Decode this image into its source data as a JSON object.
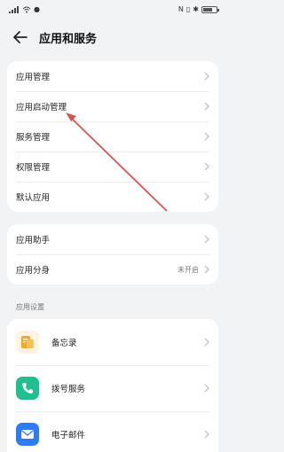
{
  "status_bar": {
    "left_icons": [
      "signal-icon",
      "wifi-icon",
      "notification-icon"
    ],
    "right_icons": [
      "nfc-icon",
      "vibrate-icon",
      "bluetooth-icon"
    ]
  },
  "header": {
    "title": "应用和服务",
    "back_icon": "back-arrow-icon"
  },
  "group1": [
    {
      "label": "应用管理"
    },
    {
      "label": "应用启动管理"
    },
    {
      "label": "服务管理"
    },
    {
      "label": "权限管理"
    },
    {
      "label": "默认应用"
    }
  ],
  "group2": [
    {
      "label": "应用助手",
      "value": ""
    },
    {
      "label": "应用分身",
      "value": "未开启"
    }
  ],
  "section_app_settings": "应用设置",
  "apps": [
    {
      "label": "备忘录",
      "icon": "memo-icon",
      "color": "#f5a623"
    },
    {
      "label": "拨号服务",
      "icon": "phone-icon",
      "color": "#1fbf8f"
    },
    {
      "label": "电子邮件",
      "icon": "email-icon",
      "color": "#2f7bf6"
    }
  ],
  "annotation": {
    "arrow_color": "#d9534f"
  },
  "colors": {
    "background": "#f1f3f5",
    "card": "#ffffff",
    "chevron": "#b8b8b8"
  }
}
